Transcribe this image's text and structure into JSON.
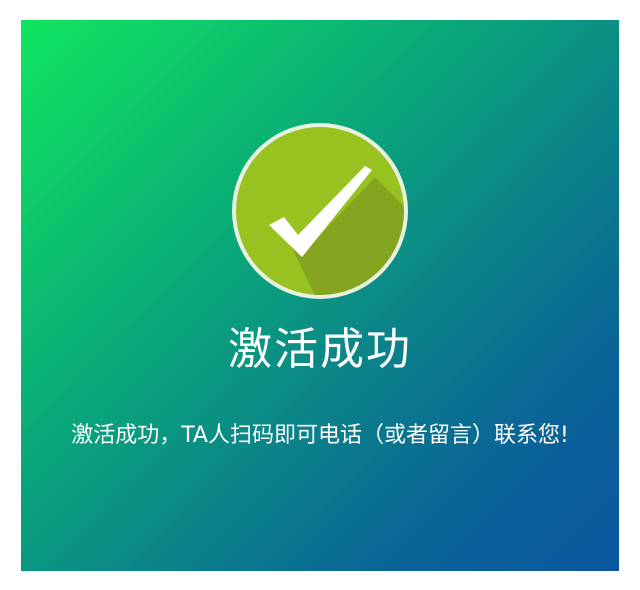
{
  "dialog": {
    "icon": "check-circle-icon",
    "title": "激活成功",
    "message": "激活成功，TA人扫码即可电话（或者留言）联系您!"
  },
  "colors": {
    "gradient_start": "#10e55f",
    "gradient_end": "#0a579f",
    "icon_circle": "#98c21f",
    "icon_ring": "#e9f0df",
    "text": "#ffffff"
  }
}
